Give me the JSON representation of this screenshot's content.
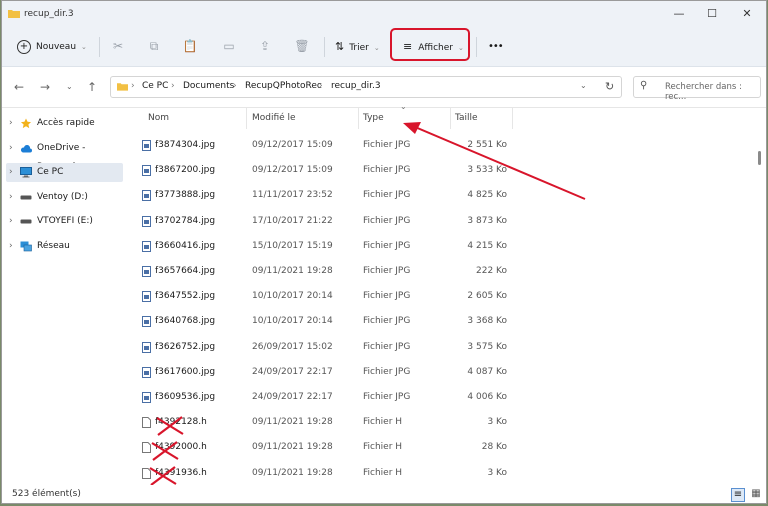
{
  "window": {
    "title": "recup_dir.3",
    "minimize_icon": "minimize-icon",
    "maximize_icon": "maximize-icon",
    "close_icon": "close-icon"
  },
  "toolbar": {
    "new_label": "Nouveau",
    "sort_label": "Trier",
    "view_label": "Afficher",
    "more_label": "•••"
  },
  "address": {
    "crumbs": [
      "Ce PC",
      "Documents",
      "RecupQPhotoRec",
      "recup_dir.3"
    ],
    "search_placeholder": "Rechercher dans : rec..."
  },
  "sidebar": {
    "items": [
      {
        "label": "Accès rapide",
        "icon": "star-icon"
      },
      {
        "label": "OneDrive - Personal",
        "icon": "cloud-icon"
      },
      {
        "label": "Ce PC",
        "icon": "computer-icon"
      },
      {
        "label": "Ventoy (D:)",
        "icon": "drive-icon"
      },
      {
        "label": "VTOYEFI (E:)",
        "icon": "drive-icon"
      },
      {
        "label": "Réseau",
        "icon": "network-icon"
      }
    ]
  },
  "columns": {
    "name": "Nom",
    "modified": "Modifié le",
    "type": "Type",
    "size": "Taille"
  },
  "files": [
    {
      "name": "f3874304.jpg",
      "date": "09/12/2017 15:09",
      "type": "Fichier JPG",
      "size": "2 551 Ko"
    },
    {
      "name": "f3867200.jpg",
      "date": "09/12/2017 15:09",
      "type": "Fichier JPG",
      "size": "3 533 Ko"
    },
    {
      "name": "f3773888.jpg",
      "date": "11/11/2017 23:52",
      "type": "Fichier JPG",
      "size": "4 825 Ko"
    },
    {
      "name": "f3702784.jpg",
      "date": "17/10/2017 21:22",
      "type": "Fichier JPG",
      "size": "3 873 Ko"
    },
    {
      "name": "f3660416.jpg",
      "date": "15/10/2017 15:19",
      "type": "Fichier JPG",
      "size": "4 215 Ko"
    },
    {
      "name": "f3657664.jpg",
      "date": "09/11/2021 19:28",
      "type": "Fichier JPG",
      "size": "222 Ko"
    },
    {
      "name": "f3647552.jpg",
      "date": "10/10/2017 20:14",
      "type": "Fichier JPG",
      "size": "2 605 Ko"
    },
    {
      "name": "f3640768.jpg",
      "date": "10/10/2017 20:14",
      "type": "Fichier JPG",
      "size": "3 368 Ko"
    },
    {
      "name": "f3626752.jpg",
      "date": "26/09/2017 15:02",
      "type": "Fichier JPG",
      "size": "3 575 Ko"
    },
    {
      "name": "f3617600.jpg",
      "date": "24/09/2017 22:17",
      "type": "Fichier JPG",
      "size": "4 087 Ko"
    },
    {
      "name": "f3609536.jpg",
      "date": "24/09/2017 22:17",
      "type": "Fichier JPG",
      "size": "4 006 Ko"
    },
    {
      "name": "f4392128.h",
      "date": "09/11/2021 19:28",
      "type": "Fichier H",
      "size": "3 Ko"
    },
    {
      "name": "f4392000.h",
      "date": "09/11/2021 19:28",
      "type": "Fichier H",
      "size": "28 Ko"
    },
    {
      "name": "f4391936.h",
      "date": "09/11/2021 19:28",
      "type": "Fichier H",
      "size": "3 Ko"
    }
  ],
  "status": {
    "count": "523 élément(s)"
  },
  "colors": {
    "accent_red": "#d8152b",
    "selection": "#e3e9f1",
    "titlebar": "#eef2f7"
  }
}
